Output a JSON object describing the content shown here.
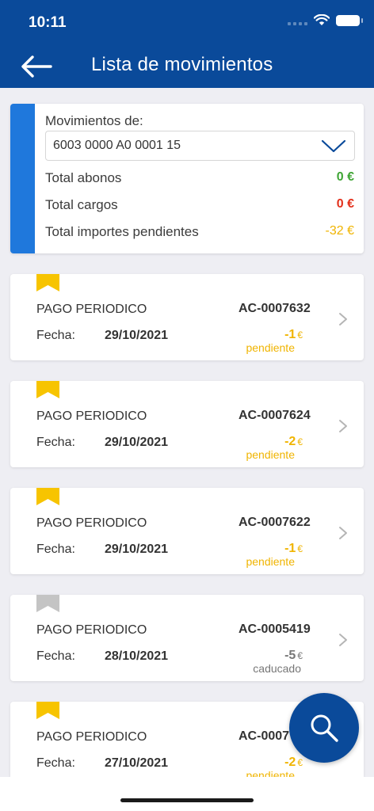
{
  "status": {
    "time": "10:11"
  },
  "header": {
    "title": "Lista de movimientos"
  },
  "summary": {
    "label": "Movimientos de:",
    "account": "6003 0000 A0 0001 15",
    "rows": [
      {
        "label": "Total abonos",
        "value": "0 €",
        "color": "#3fa535"
      },
      {
        "label": "Total cargos",
        "value": "0 €",
        "color": "#e3301b"
      },
      {
        "label": "Total importes pendientes",
        "value": "-32 €",
        "color": "#f0b400"
      }
    ]
  },
  "movements": [
    {
      "concept": "PAGO PERIODICO",
      "ref": "AC-0007632",
      "date_label": "Fecha:",
      "date": "29/10/2021",
      "amount": "-1",
      "currency": "€",
      "state": "pendiente",
      "bookmark_color": "#f7c400"
    },
    {
      "concept": "PAGO PERIODICO",
      "ref": "AC-0007624",
      "date_label": "Fecha:",
      "date": "29/10/2021",
      "amount": "-2",
      "currency": "€",
      "state": "pendiente",
      "bookmark_color": "#f7c400"
    },
    {
      "concept": "PAGO PERIODICO",
      "ref": "AC-0007622",
      "date_label": "Fecha:",
      "date": "29/10/2021",
      "amount": "-1",
      "currency": "€",
      "state": "pendiente",
      "bookmark_color": "#f7c400"
    },
    {
      "concept": "PAGO PERIODICO",
      "ref": "AC-0005419",
      "date_label": "Fecha:",
      "date": "28/10/2021",
      "amount": "-5",
      "currency": "€",
      "state": "caducado",
      "bookmark_color": "#c4c4c4"
    },
    {
      "concept": "PAGO PERIODICO",
      "ref": "AC-0007",
      "date_label": "Fecha:",
      "date": "27/10/2021",
      "amount": "-2",
      "currency": "€",
      "state": "pendiente",
      "bookmark_color": "#f7c400"
    }
  ],
  "icons": {
    "back": "arrow-left-icon",
    "dropdown": "chevron-down-icon",
    "row": "chevron-right-icon",
    "search": "search-icon"
  }
}
